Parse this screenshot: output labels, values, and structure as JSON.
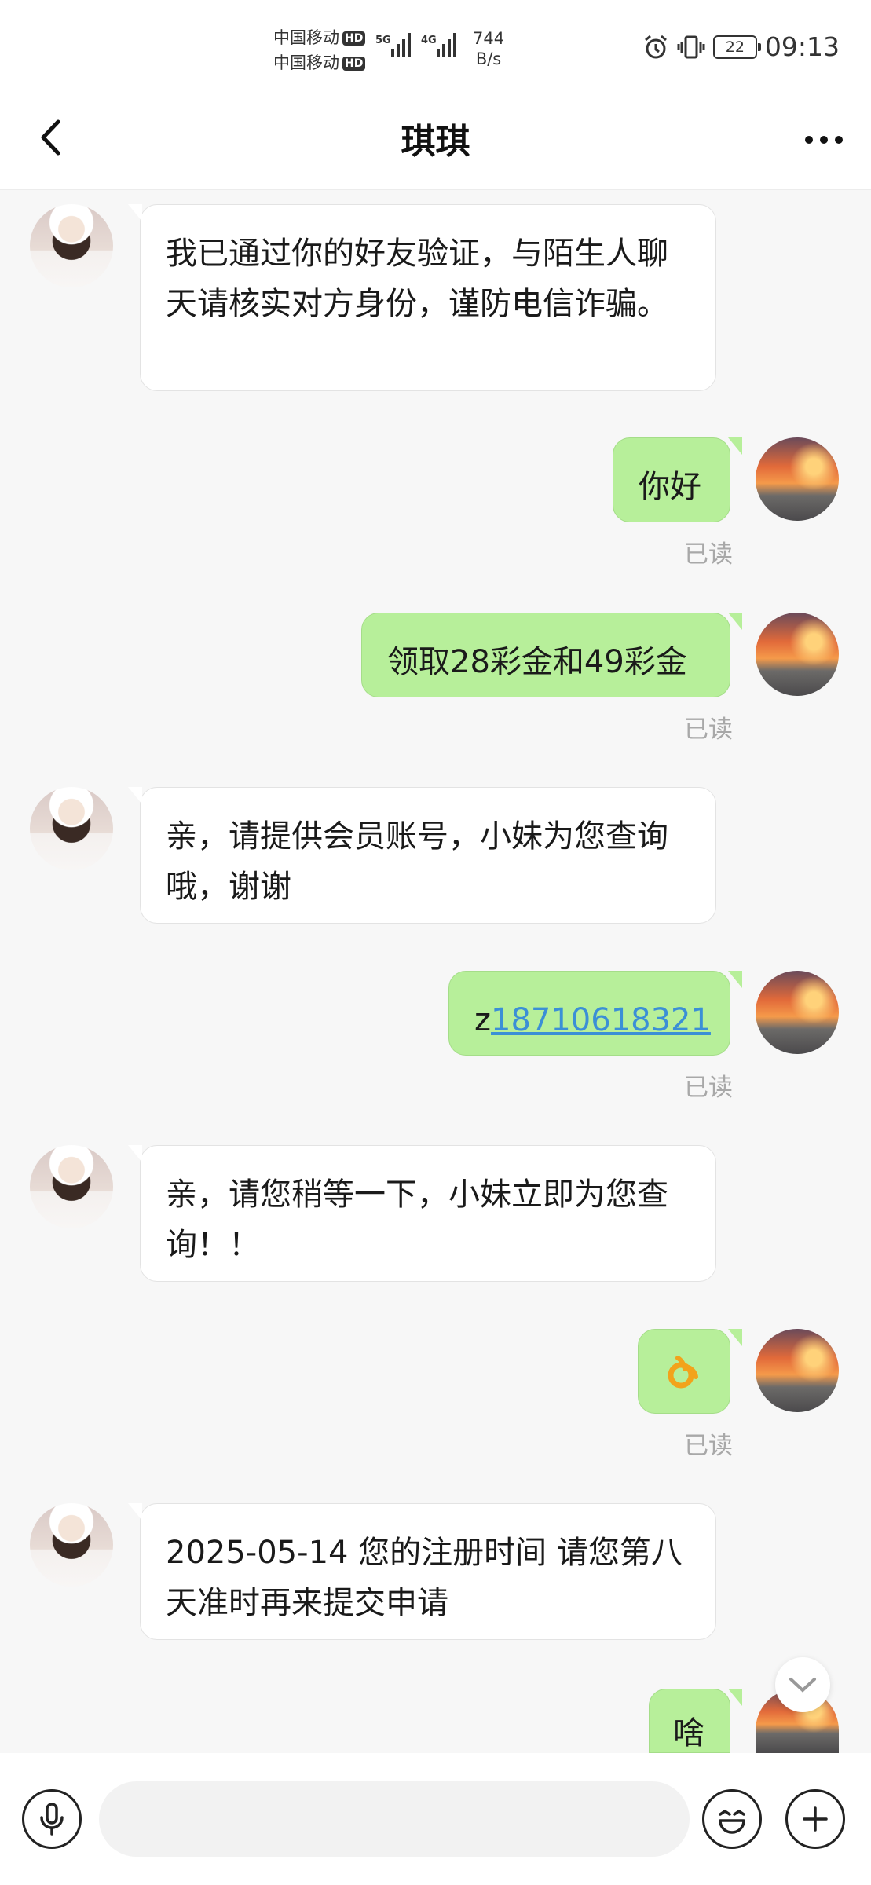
{
  "status_bar": {
    "carrier1": "中国移动",
    "carrier2": "中国移动",
    "hd": "HD",
    "net1": "5G",
    "net2": "4G",
    "speed_value": "744",
    "speed_unit": "B/s",
    "battery": "22",
    "time": "09:13"
  },
  "header": {
    "title": "琪琪",
    "back_icon": "chevron-left-icon",
    "more_icon": "more-dots-icon"
  },
  "messages": [
    {
      "from": "contact",
      "text": "我已通过你的好友验证，与陌生人聊天请核实对方身份，谨防电信诈骗。"
    },
    {
      "from": "me",
      "text": "你好",
      "status": "已读"
    },
    {
      "from": "me",
      "text": "领取28彩金和49彩金",
      "status": "已读"
    },
    {
      "from": "contact",
      "text": "亲，请提供会员账号，小妹为您查询哦，谢谢"
    },
    {
      "from": "me",
      "prefix": "z",
      "link": "18710618321",
      "status": "已读"
    },
    {
      "from": "contact",
      "text": "亲，请您稍等一下，小妹立即为您查询！！"
    },
    {
      "from": "me",
      "emoji": "ok-hand-emoji",
      "status": "已读"
    },
    {
      "from": "contact",
      "text": "2025-05-14   您的注册时间 请您第八天准时再来提交申请"
    },
    {
      "from": "me",
      "text": "啥"
    }
  ],
  "input_bar": {
    "placeholder": "",
    "voice_icon": "microphone-icon",
    "emoji_icon": "smiley-icon",
    "plus_icon": "plus-icon"
  },
  "colors": {
    "outgoing_bubble": "#b7ef9a",
    "incoming_bubble": "#ffffff",
    "background": "#f7f7f7",
    "link": "#3b8fd6"
  }
}
